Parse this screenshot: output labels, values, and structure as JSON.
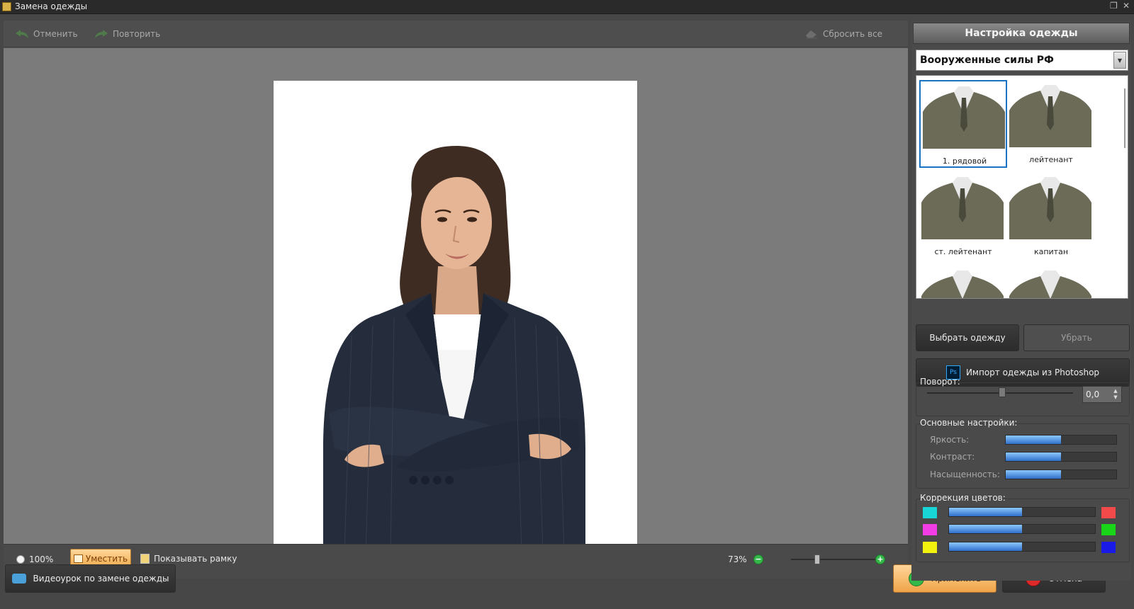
{
  "window": {
    "title": "Замена одежды"
  },
  "toolbar": {
    "undo": "Отменить",
    "redo": "Повторить",
    "reset_all": "Сбросить все"
  },
  "bottombar": {
    "zoom_100": "100%",
    "fit": "Уместить",
    "show_frame": "Показывать рамку",
    "zoom_value": "73%",
    "zoom_level": 73
  },
  "footer": {
    "video_tutorial": "Видеоурок по замене одежды",
    "apply": "Применить",
    "cancel": "Отмена"
  },
  "panel": {
    "title": "Настройка одежды",
    "category": "Вооруженные силы РФ",
    "items": [
      {
        "label": "1. рядовой",
        "selected": true
      },
      {
        "label": "лейтенант",
        "selected": false
      },
      {
        "label": "ст. лейтенант",
        "selected": false
      },
      {
        "label": "капитан",
        "selected": false
      }
    ],
    "select_button": "Выбрать одежду",
    "remove_button": "Убрать",
    "import_button": "Импорт одежды из Photoshop",
    "ps_badge": "Ps",
    "rotation": {
      "label": "Поворот:",
      "value": "0,0"
    },
    "basic": {
      "title": "Основные настройки:",
      "brightness": {
        "label": "Яркость:",
        "level": 0.5
      },
      "contrast": {
        "label": "Контраст:",
        "level": 0.5
      },
      "saturation": {
        "label": "Насыщенность:",
        "level": 0.5
      }
    },
    "color_correction": {
      "title": "Коррекция цветов:",
      "rows": [
        {
          "left": "#19d6d6",
          "right": "#f24a4a",
          "level": 0.5
        },
        {
          "left": "#f23ce6",
          "right": "#19d619",
          "level": 0.5
        },
        {
          "left": "#f2f20f",
          "right": "#1a1ae6",
          "level": 0.5
        }
      ]
    }
  },
  "colors": {
    "accent_blue": "#1a73c7",
    "apply_orange": "#f0a448",
    "canvas_gray": "#7b7b7b"
  }
}
